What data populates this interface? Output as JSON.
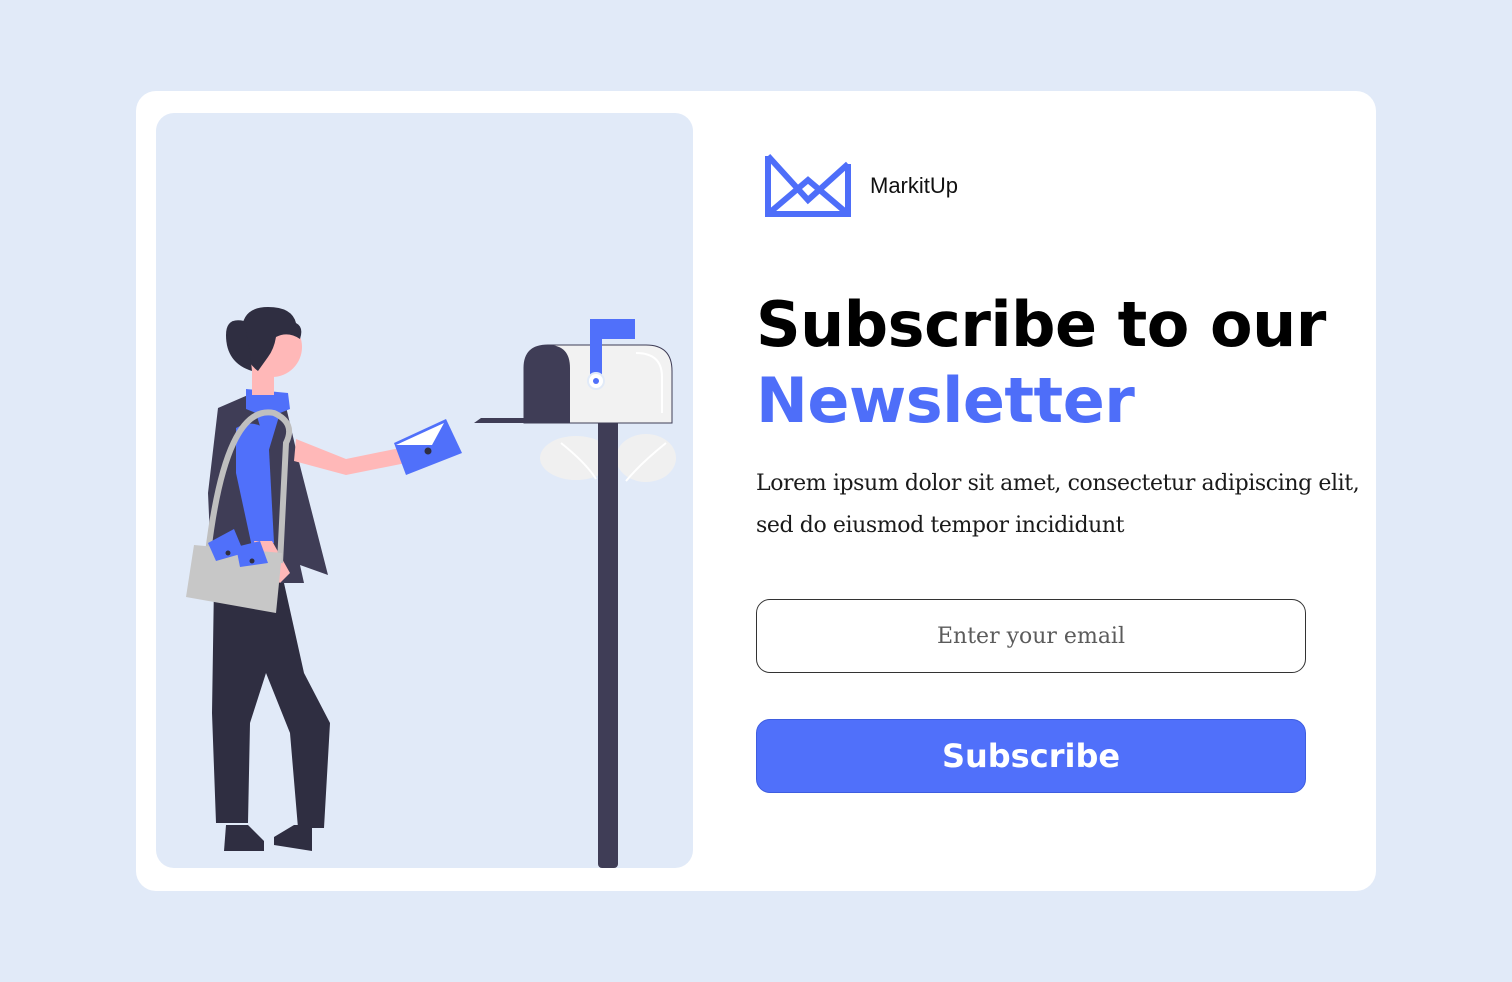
{
  "brand": {
    "name": "MarkitUp",
    "logo_icon": "envelope-logo-icon",
    "accent_color": "#4e6ef9"
  },
  "hero": {
    "title_line1": "Subscribe to our",
    "title_line2": "Newsletter",
    "description": "Lorem ipsum dolor sit amet, consectetur adipiscing elit, sed do eiusmod tempor incididunt"
  },
  "form": {
    "email_placeholder": "Enter your email",
    "email_value": "",
    "subscribe_label": "Subscribe",
    "button_color": "#5070fa"
  },
  "illustration": {
    "subject": "mailman-putting-letter-in-mailbox-illustration"
  },
  "colors": {
    "page_background": "#e1eaf8",
    "card_background": "#ffffff",
    "panel_background": "#e1eaf8"
  }
}
